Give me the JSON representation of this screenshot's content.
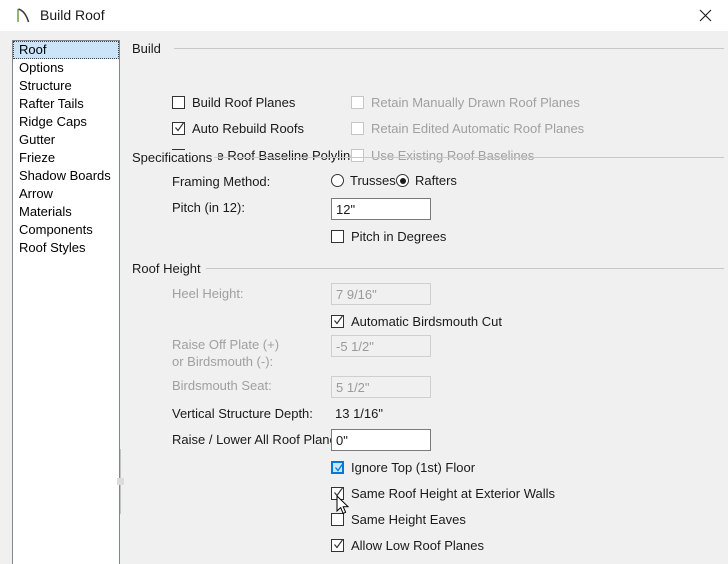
{
  "window": {
    "title": "Build Roof",
    "icon": "roof-icon",
    "close_label": "✕"
  },
  "sidebar": {
    "items": [
      {
        "label": "Roof",
        "selected": true
      },
      {
        "label": "Options",
        "selected": false
      },
      {
        "label": "Structure",
        "selected": false
      },
      {
        "label": "Rafter Tails",
        "selected": false
      },
      {
        "label": "Ridge Caps",
        "selected": false
      },
      {
        "label": "Gutter",
        "selected": false
      },
      {
        "label": "Frieze",
        "selected": false
      },
      {
        "label": "Shadow Boards",
        "selected": false
      },
      {
        "label": "Arrow",
        "selected": false
      },
      {
        "label": "Materials",
        "selected": false
      },
      {
        "label": "Components",
        "selected": false
      },
      {
        "label": "Roof Styles",
        "selected": false
      }
    ]
  },
  "groups": {
    "build": "Build",
    "specifications": "Specifications",
    "roof_height": "Roof Height"
  },
  "build": {
    "build_roof_planes": {
      "label": "Build Roof Planes",
      "checked": false,
      "enabled": true
    },
    "auto_rebuild_roofs": {
      "label": "Auto Rebuild Roofs",
      "checked": true,
      "enabled": true
    },
    "make_roof_baseline_polylines": {
      "label": "Make Roof Baseline Polylines",
      "checked": false,
      "enabled": true
    },
    "retain_manually_drawn_roof_planes": {
      "label": "Retain Manually Drawn Roof Planes",
      "checked": false,
      "enabled": false
    },
    "retain_edited_automatic_roof_planes": {
      "label": "Retain Edited Automatic Roof Planes",
      "checked": false,
      "enabled": false
    },
    "use_existing_roof_baselines": {
      "label": "Use Existing Roof Baselines",
      "checked": false,
      "enabled": false
    }
  },
  "specifications": {
    "framing_method_label": "Framing Method:",
    "trusses_label": "Trusses",
    "rafters_label": "Rafters",
    "framing_method_value": "Rafters",
    "pitch_label": "Pitch (in 12):",
    "pitch_value": "12\"",
    "pitch_in_degrees_label": "Pitch in Degrees",
    "pitch_in_degrees_checked": false
  },
  "roof_height": {
    "heel_height_label": "Heel Height:",
    "heel_height_value": "7 9/16\"",
    "automatic_birdsmouth_cut_label": "Automatic Birdsmouth Cut",
    "automatic_birdsmouth_cut_checked": true,
    "raise_off_plate_label_line1": "Raise Off Plate (+)",
    "raise_off_plate_label_line2": "or Birdsmouth (-):",
    "raise_off_plate_value": "-5 1/2\"",
    "birdsmouth_seat_label": "Birdsmouth Seat:",
    "birdsmouth_seat_value": "5 1/2\"",
    "vertical_structure_depth_label": "Vertical Structure Depth:",
    "vertical_structure_depth_value": "13 1/16\"",
    "raise_lower_all_roof_planes_label": "Raise / Lower All Roof Planes:",
    "raise_lower_all_roof_planes_value": "0\"",
    "ignore_top_floor_label": "Ignore Top (1st) Floor",
    "ignore_top_floor_checked": true,
    "same_roof_height_at_exterior_walls_label": "Same Roof Height at Exterior Walls",
    "same_roof_height_at_exterior_walls_checked": true,
    "same_height_eaves_label": "Same Height Eaves",
    "same_height_eaves_checked": false,
    "allow_low_roof_planes_label": "Allow Low Roof Planes",
    "allow_low_roof_planes_checked": true
  },
  "colors": {
    "window_bg": "#f0f0f0",
    "titlebar_bg": "#ffffff",
    "selection": "#cce4f7",
    "accent": "#0078d7",
    "icon_green": "#6aa84f",
    "disabled_text": "#a0a0a0"
  }
}
